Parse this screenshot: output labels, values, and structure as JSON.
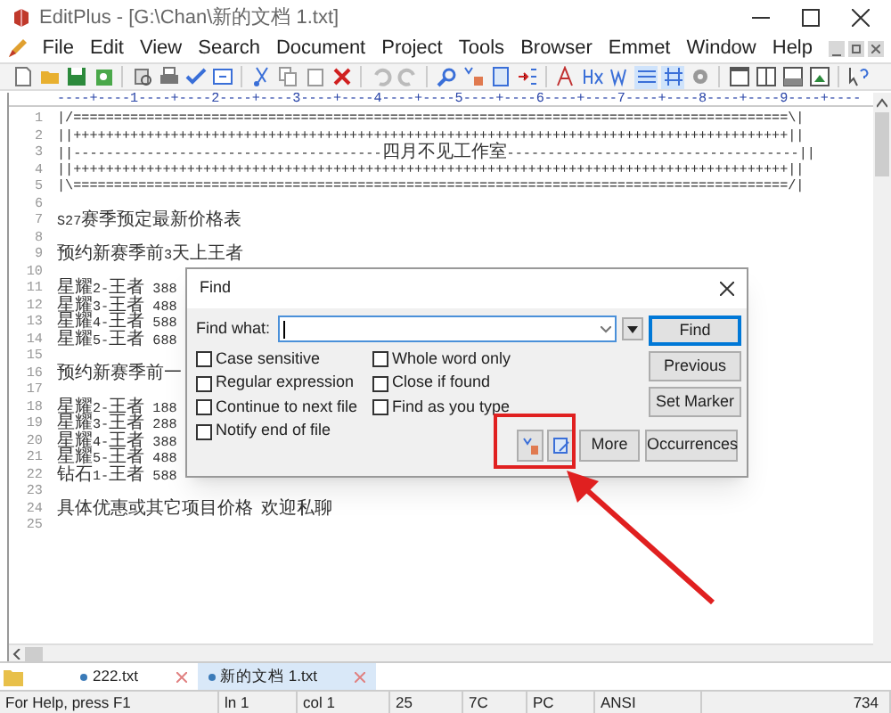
{
  "window": {
    "title": "EditPlus - [G:\\Chan\\新的文档 1.txt]"
  },
  "menu": [
    "File",
    "Edit",
    "View",
    "Search",
    "Document",
    "Project",
    "Tools",
    "Browser",
    "Emmet",
    "Window",
    "Help"
  ],
  "ruler": "----+----1----+----2----+----3----+----4----+----5----+----6----+----7----+----8----+----9----+----",
  "editor": {
    "lines": [
      {
        "number": "1",
        "text": "|/========================================================================================\\|"
      },
      {
        "number": "2",
        "text": "||++++++++++++++++++++++++++++++++++++++++++++++++++++++++++++++++++++++++++++++++++++++++||"
      },
      {
        "number": "3",
        "text": "||--------------------------------------四月不见工作室------------------------------------||"
      },
      {
        "number": "4",
        "text": "||++++++++++++++++++++++++++++++++++++++++++++++++++++++++++++++++++++++++++++++++++++++++||"
      },
      {
        "number": "5",
        "text": "|\\========================================================================================/|"
      },
      {
        "number": "6"
      },
      {
        "number": "7",
        "text": "S27赛季预定最新价格表"
      },
      {
        "number": "8"
      },
      {
        "number": "9",
        "text": "预约新赛季前3天上王者"
      },
      {
        "number": "10"
      },
      {
        "number": "11",
        "text": "星耀2-王者 388"
      },
      {
        "number": "12",
        "text": "星耀3-王者 488"
      },
      {
        "number": "13",
        "text": "星耀4-王者 588"
      },
      {
        "number": "14",
        "text": "星耀5-王者 688"
      },
      {
        "number": "15"
      },
      {
        "number": "16",
        "text": "预约新赛季前一"
      },
      {
        "number": "17"
      },
      {
        "number": "18",
        "text": "星耀2-王者 188"
      },
      {
        "number": "19",
        "text": "星耀3-王者 288"
      },
      {
        "number": "20",
        "text": "星耀4-王者 388"
      },
      {
        "number": "21",
        "text": "星耀5-王者 488"
      },
      {
        "number": "22",
        "text": "钻石1-王者 588"
      },
      {
        "number": "23"
      },
      {
        "number": "24",
        "text": "具体优惠或其它项目价格 欢迎私聊"
      },
      {
        "number": "25"
      }
    ]
  },
  "find_dialog": {
    "title": "Find",
    "find_what_label": "Find what:",
    "options": [
      {
        "label": "Case sensitive",
        "checked": false
      },
      {
        "label": "Regular expression",
        "checked": false
      },
      {
        "label": "Continue to next file",
        "checked": false
      },
      {
        "label": "Notify end of file",
        "checked": false
      },
      {
        "label": "Whole word only",
        "checked": false
      },
      {
        "label": "Close if found",
        "checked": false
      },
      {
        "label": "Find as you type",
        "checked": false
      }
    ],
    "buttons": [
      "Find",
      "Previous",
      "Set Marker"
    ],
    "bottom_buttons": [
      "More",
      "Occurrences"
    ]
  },
  "file_tabs": [
    {
      "label": "222.txt",
      "selected": false
    },
    {
      "label": "新的文档 1.txt",
      "selected": true
    }
  ],
  "status_bar": [
    "For Help, press F1",
    "ln 1",
    "col 1",
    "25",
    "7C",
    "PC",
    "ANSI",
    "734"
  ]
}
